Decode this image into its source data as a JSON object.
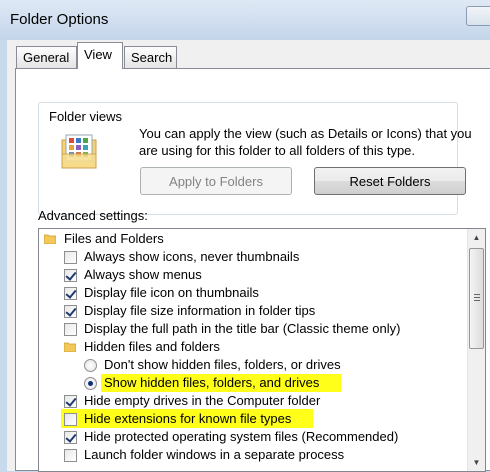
{
  "window": {
    "title": "Folder Options"
  },
  "tabs": [
    {
      "label": "General"
    },
    {
      "label": "View"
    },
    {
      "label": "Search"
    }
  ],
  "folder_views": {
    "group_label": "Folder views",
    "description": "You can apply the view (such as Details or Icons) that you are using for this folder to all folders of this type.",
    "apply_button": "Apply to Folders",
    "reset_button": "Reset Folders"
  },
  "advanced": {
    "label": "Advanced settings:",
    "items": [
      {
        "label": "Files and Folders",
        "control": "folder",
        "checked": false,
        "highlighted": false
      },
      {
        "label": "Always show icons, never thumbnails",
        "control": "checkbox",
        "checked": false,
        "highlighted": false
      },
      {
        "label": "Always show menus",
        "control": "checkbox",
        "checked": true,
        "highlighted": false
      },
      {
        "label": "Display file icon on thumbnails",
        "control": "checkbox",
        "checked": true,
        "highlighted": false
      },
      {
        "label": "Display file size information in folder tips",
        "control": "checkbox",
        "checked": true,
        "highlighted": false
      },
      {
        "label": "Display the full path in the title bar (Classic theme only)",
        "control": "checkbox",
        "checked": false,
        "highlighted": false
      },
      {
        "label": "Hidden files and folders",
        "control": "folder",
        "checked": false,
        "highlighted": false
      },
      {
        "label": "Don't show hidden files, folders, or drives",
        "control": "radio",
        "checked": false,
        "highlighted": false
      },
      {
        "label": "Show hidden files, folders, and drives",
        "control": "radio",
        "checked": true,
        "highlighted": true
      },
      {
        "label": "Hide empty drives in the Computer folder",
        "control": "checkbox",
        "checked": true,
        "highlighted": false
      },
      {
        "label": "Hide extensions for known file types",
        "control": "checkbox",
        "checked": false,
        "highlighted": true
      },
      {
        "label": "Hide protected operating system files (Recommended)",
        "control": "checkbox",
        "checked": true,
        "highlighted": false
      },
      {
        "label": "Launch folder windows in a separate process",
        "control": "checkbox",
        "checked": false,
        "highlighted": false
      }
    ]
  },
  "colors": {
    "highlight": "#ffff1a",
    "check": "#1f3b6f",
    "radio_dot": "#0c2f7a"
  }
}
